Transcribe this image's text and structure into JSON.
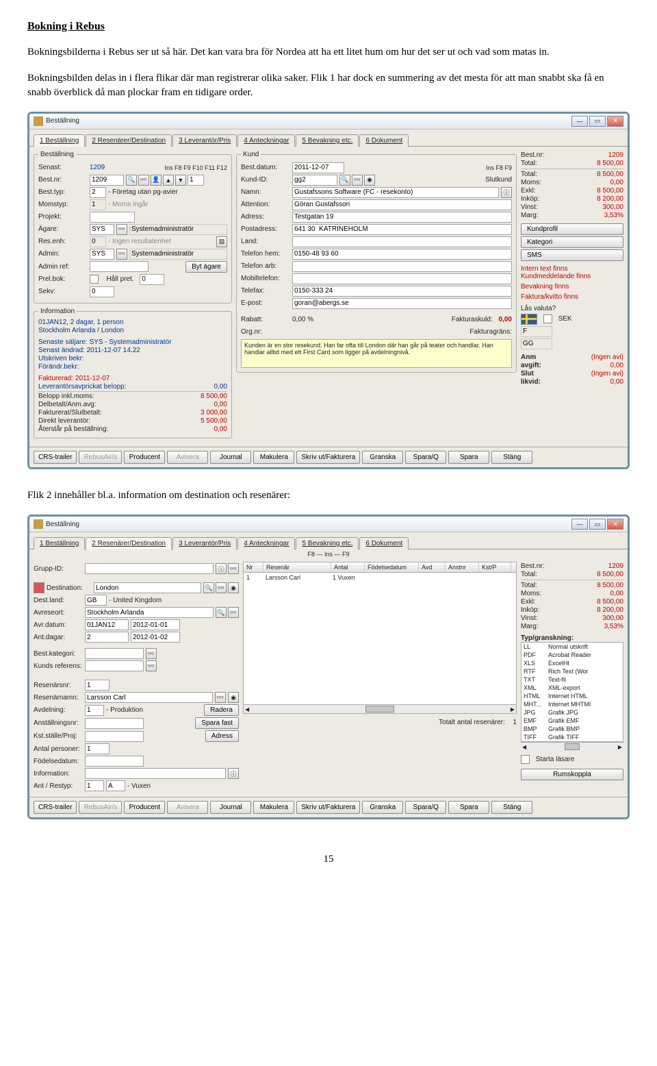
{
  "heading": "Bokning i Rebus",
  "para1": "Bokningsbilderna i Rebus ser ut så här. Det kan vara bra för Nordea att ha ett litet hum om hur det ser ut och vad som matas in.",
  "para2": "Bokningsbilden delas in i flera flikar där man registrerar olika saker. Flik 1 har dock en summering av det mesta för att man snabbt ska få en snabb överblick då man plockar fram en tidigare order.",
  "midpara": "Flik 2 innehåller bl.a. information om destination och resenärer:",
  "pagenum": "15",
  "win": {
    "title": "Beställning"
  },
  "tabs": {
    "t1": "1 Beställning",
    "t2": "2 Resenärer/Destination",
    "t3": "3 Leverantör/Pris",
    "t4": "4 Anteckningar",
    "t5": "5 Bevakning etc.",
    "t6": "6 Dokument"
  },
  "fkeys": "Ins    F8    F9    F10    F11    F12",
  "fkeys2": "Ins    F8    F9",
  "f8ins": "F8 — Ins — F9",
  "order1": {
    "fs_best": "Beställning",
    "senast_l": "Senast:",
    "senast_v": "1209",
    "bestnr_l": "Best.nr:",
    "bestnr_v": "1209",
    "besttyp_l": "Best.typ:",
    "besttyp_v": "2",
    "besttyp_t": "- Företag utan pg-avier",
    "momstyp_l": "Momstyp:",
    "momstyp_v": "1",
    "momstyp_t": "- Moms ingår",
    "projekt_l": "Projekt:",
    "agare_l": "Ägare:",
    "agare_v": "SYS",
    "agare_t": "Systemadministratör",
    "resenh_l": "Res.enh:",
    "resenh_v": "0",
    "resenh_t": "- Ingen resultatenhet",
    "admin_l": "Admin:",
    "admin_v": "SYS",
    "admin_t": "Systemadministratör",
    "adminref_l": "Admin ref:",
    "bytag_btn": "Byt ägare",
    "prelbok_l": "Prel.bok:",
    "hallpret_l": "Håll pret.",
    "hallpret_v": "0",
    "sekv_l": "Sekv:",
    "sekv_v": "0",
    "info_fs": "Information",
    "info1": "01JAN12, 2 dagar, 1 person",
    "info2": "Stockholm Arlanda / London",
    "info3": "Senaste säljare: SYS - Systemadministratör",
    "info4": "Senast ändrad: 2011-12-07 14.22",
    "info5": "Utskriven bekr:",
    "info6": "Förändr.bekr:",
    "info7": "Fakturerad: 2011-12-07",
    "info8": "Leverantörsavprickat belopp:",
    "info8v": "0,00",
    "b1l": "Belopp inkl.moms:",
    "b1v": "8 500,00",
    "b2l": "Delbetalt/Anm.avg:",
    "b2v": "0,00",
    "b3l": "Fakturerat/Slutbetalt:",
    "b3v": "3 000,00",
    "b4l": "Direkt leverantör:",
    "b4v": "5 500,00",
    "b5l": "Återstår på beställning:",
    "b5v": "0,00"
  },
  "kund1": {
    "fs": "Kund",
    "bestdat_l": "Best.datum:",
    "bestdat_v": "2011-12-07",
    "kundid_l": "Kund-ID:",
    "kundid_v": "gg2",
    "slutkund_l": "Slutkund",
    "namn_l": "Namn:",
    "namn_v": "Gustafssons Software (FC - resekonto)",
    "att_l": "Attention:",
    "att_v": "Göran Gustafsson",
    "adr_l": "Adress:",
    "adr_v": "Testgatan 19",
    "postadr_l": "Postadress:",
    "postadr_v": "641 30  KATRINEHOLM",
    "land_l": "Land:",
    "telh_l": "Telefon hem:",
    "telh_v": "0150-48 93 60",
    "tela_l": "Telefon arb:",
    "mobil_l": "Mobiltelefon:",
    "fax_l": "Telefax:",
    "fax_v": "0150-333 24",
    "epost_l": "E-post:",
    "epost_v": "goran@abergs.se",
    "rabatt_l": "Rabatt:",
    "rabatt_v": "0,00 %",
    "fskuld_l": "Fakturaskuld:",
    "fskuld_v": "0,00",
    "org_l": "Org.nr:",
    "fgrans_l": "Fakturagräns:",
    "note": "Kunden är en stor resekund. Han far ofta till London där han går på teater och handlar. Han handlar alltid med ett First Card som ligger på avdelningnivå.",
    "kundprofil_btn": "Kundprofil",
    "kategori_btn": "Kategori",
    "sms_btn": "SMS"
  },
  "r1": {
    "bestnr_l": "Best.nr:",
    "bestnr_v": "1209",
    "total_l": "Total:",
    "total_v": "8 500,00",
    "total2_l": "Total:",
    "total2_v": "8 500,00",
    "moms_l": "Moms:",
    "moms_v": "0,00",
    "exkl_l": "Exkl:",
    "exkl_v": "8 500,00",
    "inkop_l": "Inköp:",
    "inkop_v": "8 200,00",
    "vinst_l": "Vinst:",
    "vinst_v": "300,00",
    "marg_l": "Marg:",
    "marg_v": "3,53%",
    "intern": "Intern text finns",
    "kundmed": "Kundmeddelande finns",
    "bevak": "Bevakning finns",
    "fakt": "Faktura/kvitto finns",
    "lasval": "Lås valuta?",
    "sek": "SEK",
    "f": "F",
    "gg": "GG",
    "anm_l": "Anm",
    "ingen": "(Ingen avi)",
    "avgift_l": "avgift:",
    "avgift_v": "0,00",
    "slut_l": "Slut",
    "likvid_l": "likvid:",
    "likvid_v": "0,00"
  },
  "bb": {
    "b1": "CRS-trailer",
    "b2": "RebusAir/s",
    "b3": "Producent",
    "b4": "Avisera",
    "b5": "Journal",
    "b6": "Makulera",
    "b7": "Skriv ut/Fakturera",
    "b8": "Granska",
    "b9": "Spara/Q",
    "b10": "Spara",
    "b11": "Stäng"
  },
  "order2": {
    "grupp_l": "Grupp-ID:",
    "dest_l": "Destination:",
    "dest_v": "London",
    "destland_l": "Dest.land:",
    "destland_v": "GB",
    "destland_t": "- United Kingdom",
    "avreseort_l": "Avreseort:",
    "avreseort_v": "Stockholm Arlanda",
    "avrdatum_l": "Avr.datum:",
    "avrdatum_v": "01JAN12",
    "avrdatum_v2": "2012-01-01",
    "antdagar_l": "Ant.dagar:",
    "antdagar_v": "2",
    "antdagar_v2": "2012-01-02",
    "bestkat_l": "Best.kategori:",
    "kundref_l": "Kunds referens:",
    "resenarsnr_l": "Resenärsnr:",
    "resenarsnr_v": "1",
    "resenamn_l": "Resenärnamn:",
    "resenamn_v": "Larsson Carl",
    "avd_l": "Avdelning:",
    "avd_v": "1",
    "avd_t": "- Produktion",
    "anst_l": "Anställningsnr:",
    "kst_l": "Kst.ställe/Proj:",
    "antpers_l": "Antal personer:",
    "antpers_v": "1",
    "fodelse_l": "Födelsedatum:",
    "infol": "Information:",
    "antrestyp_l": "Ant / Restyp:",
    "antrestyp_v": "1",
    "antrestyp_v2": "A",
    "antrestyp_t": "- Vuxen",
    "radera_btn": "Radera",
    "sparafast_btn": "Spara fast",
    "adress_btn": "Adress",
    "totres_l": "Totalt antal resenärer:",
    "totres_v": "1"
  },
  "table": {
    "h_n": "Nr",
    "h_r": "Resenär",
    "h_a": "Antal",
    "h_f": "Födelsedatum",
    "h_av": "Avd",
    "h_an": "Anstnr",
    "h_k": "Kst/P",
    "row_n": "1",
    "row_r": "Larsson Carl",
    "row_a": "1 Vuxen"
  },
  "typ": {
    "title": "Typ/granskning:",
    "rows": [
      [
        "LL",
        "Normal utskrift"
      ],
      [
        "PDF",
        "Acrobat Reader"
      ],
      [
        "XLS",
        "ExcelHt"
      ],
      [
        "RTF",
        "Rich Text (Wor"
      ],
      [
        "TXT",
        "Text-fil"
      ],
      [
        "XML",
        "XML-export"
      ],
      [
        "HTML",
        "Internet HTML"
      ],
      [
        "MHT...",
        "Internet MHTMl"
      ],
      [
        "JPG",
        "Grafik JPG"
      ],
      [
        "EMF",
        "Grafik EMF"
      ],
      [
        "BMP",
        "Grafik BMP"
      ],
      [
        "TIFF",
        "Grafik TIFF"
      ]
    ],
    "startalasare": "Starta läsare",
    "rumskoppla": "Rumskoppla"
  }
}
